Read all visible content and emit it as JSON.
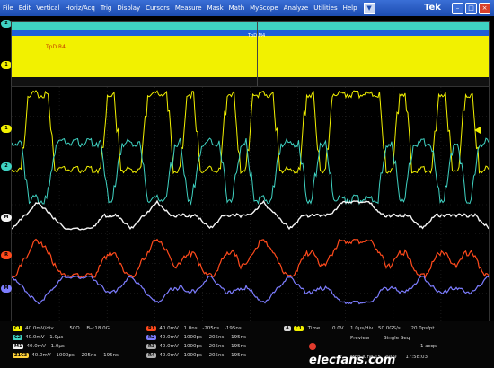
{
  "menu": {
    "items": [
      "File",
      "Edit",
      "Vertical",
      "Horiz/Acq",
      "Trig",
      "Display",
      "Cursors",
      "Measure",
      "Mask",
      "Math",
      "MyScope",
      "Analyze",
      "Utilities",
      "Help"
    ],
    "dropdown_icon": "triangle-down-icon"
  },
  "brand": "Tek",
  "window_buttons": {
    "minimize": "–",
    "maximize": "□",
    "close": "×"
  },
  "overview": {
    "label": "TpD R4",
    "trigger_label": "TpD M4",
    "markers": [
      "2",
      "1"
    ]
  },
  "channel_markers": [
    {
      "id": "1",
      "color": "#f2f100"
    },
    {
      "id": "2",
      "color": "#3fd2c2"
    },
    {
      "id": "M",
      "color": "#ffffff"
    },
    {
      "id": "R",
      "color": "#ff4a1c"
    },
    {
      "id": "M",
      "color": "#7d7dff"
    }
  ],
  "colors": {
    "ch1": "#f2f100",
    "ch2": "#3fd2c2",
    "math1": "#f4f4f4",
    "ref1": "#ff4a1c",
    "ref2": "#7d7dff"
  },
  "readouts": {
    "ch1": {
      "badge": "C1",
      "scale": "40.0mV/div",
      "impedance": "50Ω",
      "bw": "Bₘ:18.0G"
    },
    "ch2": {
      "badge": "C2",
      "scale": "40.0mV",
      "time": "1.0μs"
    },
    "m1": {
      "badge": "M1",
      "scale": "40.0mV",
      "time": "1.0μs"
    },
    "z1": {
      "badge": "Z1C3",
      "scale": "40.0mV",
      "time": "1000ps",
      "pos": "-205ns",
      "pos2": "-195ns"
    },
    "r1": {
      "badge": "R1",
      "scale": "40.0mV",
      "time": "1.0ns",
      "pos": "-205ns",
      "pos2": "-195ns"
    },
    "r2": {
      "badge": "R2",
      "scale": "40.0mV",
      "time": "1000ps",
      "pos": "-205ns",
      "pos2": "-195ns"
    },
    "r3": {
      "badge": "R3",
      "scale": "40.0mV",
      "time": "1000ps",
      "pos": "-205ns",
      "pos2": "-195ns"
    },
    "r4": {
      "badge": "R4",
      "scale": "40.0mV",
      "time": "1000ps",
      "pos": "-205ns",
      "pos2": "-195ns"
    },
    "trigger": {
      "mode": "A",
      "badge": "C1",
      "label": "Time",
      "value": "0.0V"
    },
    "acq": {
      "timebase": "1.0μs/div",
      "rate": "50.0GS/s",
      "res": "20.0ps/pt",
      "state": "Preview",
      "mode": "Single Seq",
      "samples": "1 acqs",
      "date": "Mon  June 15, 2009",
      "time": "17:58:03"
    }
  },
  "watermark": "elecfans.com"
}
